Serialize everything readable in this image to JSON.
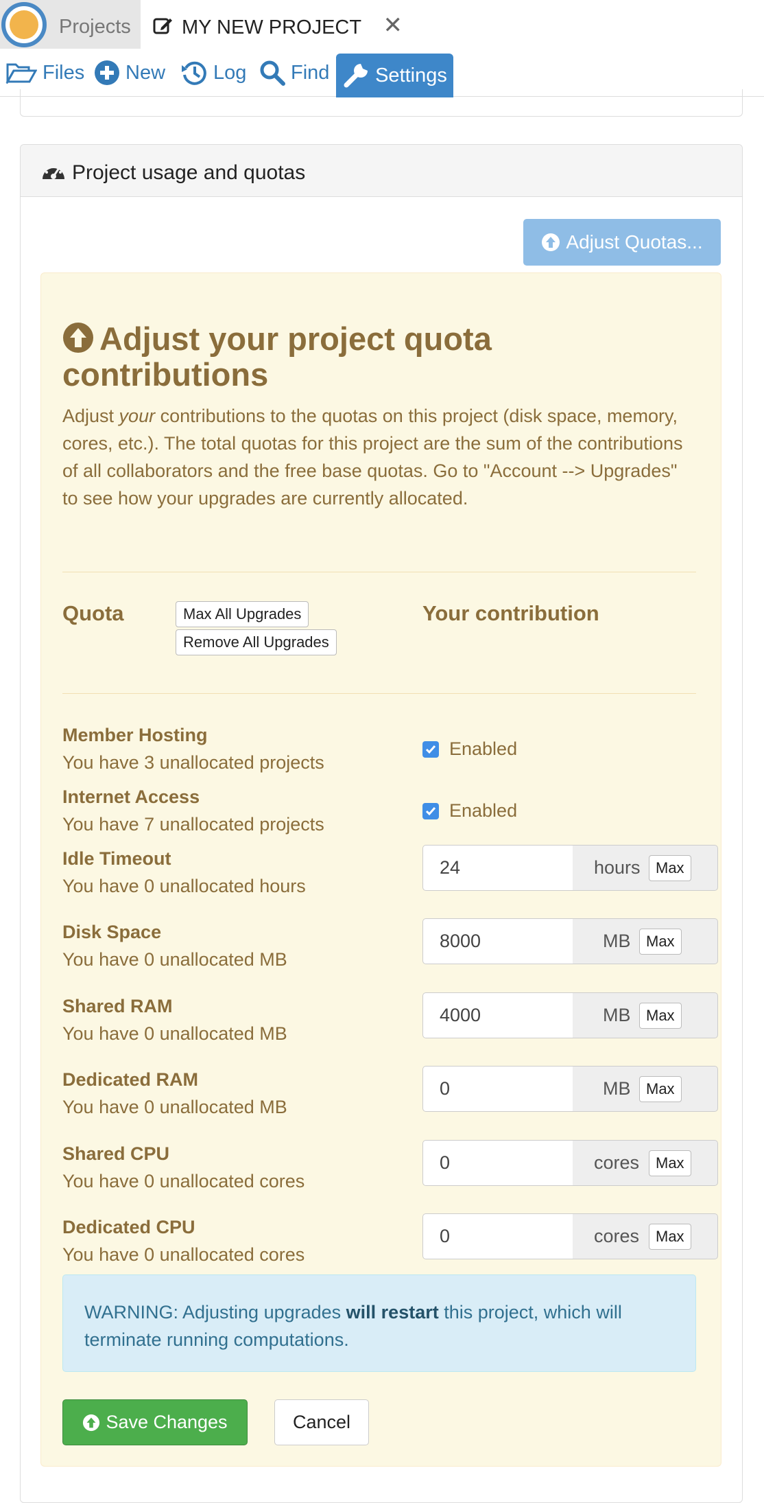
{
  "tabs": {
    "projects_label": "Projects",
    "active_project": "MY NEW PROJECT"
  },
  "nav": {
    "files": "Files",
    "new": "New",
    "log": "Log",
    "find": "Find",
    "settings": "Settings"
  },
  "panel": {
    "title": "Project usage and quotas",
    "adjust_button": "Adjust Quotas...",
    "heading": "Adjust your project quota contributions",
    "description_pre": "Adjust ",
    "description_em": "your",
    "description_post": " contributions to the quotas on this project (disk space, memory, cores, etc.). The total quotas for this project are the sum of the contributions of all collaborators and the free base quotas. Go to \"Account --> Upgrades\" to see how your upgrades are currently allocated.",
    "col_quota": "Quota",
    "max_all": "Max All Upgrades",
    "remove_all": "Remove All Upgrades",
    "col_contribution": "Your contribution",
    "member_hosting": {
      "title": "Member Hosting",
      "sub": "You have 3 unallocated projects",
      "label": "Enabled",
      "checked": true
    },
    "internet_access": {
      "title": "Internet Access",
      "sub": "You have 7 unallocated projects",
      "label": "Enabled",
      "checked": true
    },
    "rows": [
      {
        "title": "Idle Timeout",
        "sub": "You have 0 unallocated hours",
        "value": "24",
        "unit": "hours",
        "max": "Max"
      },
      {
        "title": "Disk Space",
        "sub": "You have 0 unallocated MB",
        "value": "8000",
        "unit": "MB",
        "max": "Max"
      },
      {
        "title": "Shared RAM",
        "sub": "You have 0 unallocated MB",
        "value": "4000",
        "unit": "MB",
        "max": "Max"
      },
      {
        "title": "Dedicated RAM",
        "sub": "You have 0 unallocated MB",
        "value": "0",
        "unit": "MB",
        "max": "Max"
      },
      {
        "title": "Shared CPU",
        "sub": "You have 0 unallocated cores",
        "value": "0",
        "unit": "cores",
        "max": "Max"
      },
      {
        "title": "Dedicated CPU",
        "sub": "You have 0 unallocated cores",
        "value": "0",
        "unit": "cores",
        "max": "Max"
      }
    ],
    "warning_pre": "WARNING: Adjusting upgrades ",
    "warning_bold": "will restart",
    "warning_post": " this project, which will terminate running computations.",
    "save": "Save Changes",
    "cancel": "Cancel"
  },
  "colors": {
    "accent": "#3e87c9",
    "warning_text": "#8a6d3b",
    "well_bg": "#fcf8e3",
    "success": "#4cae4c"
  }
}
